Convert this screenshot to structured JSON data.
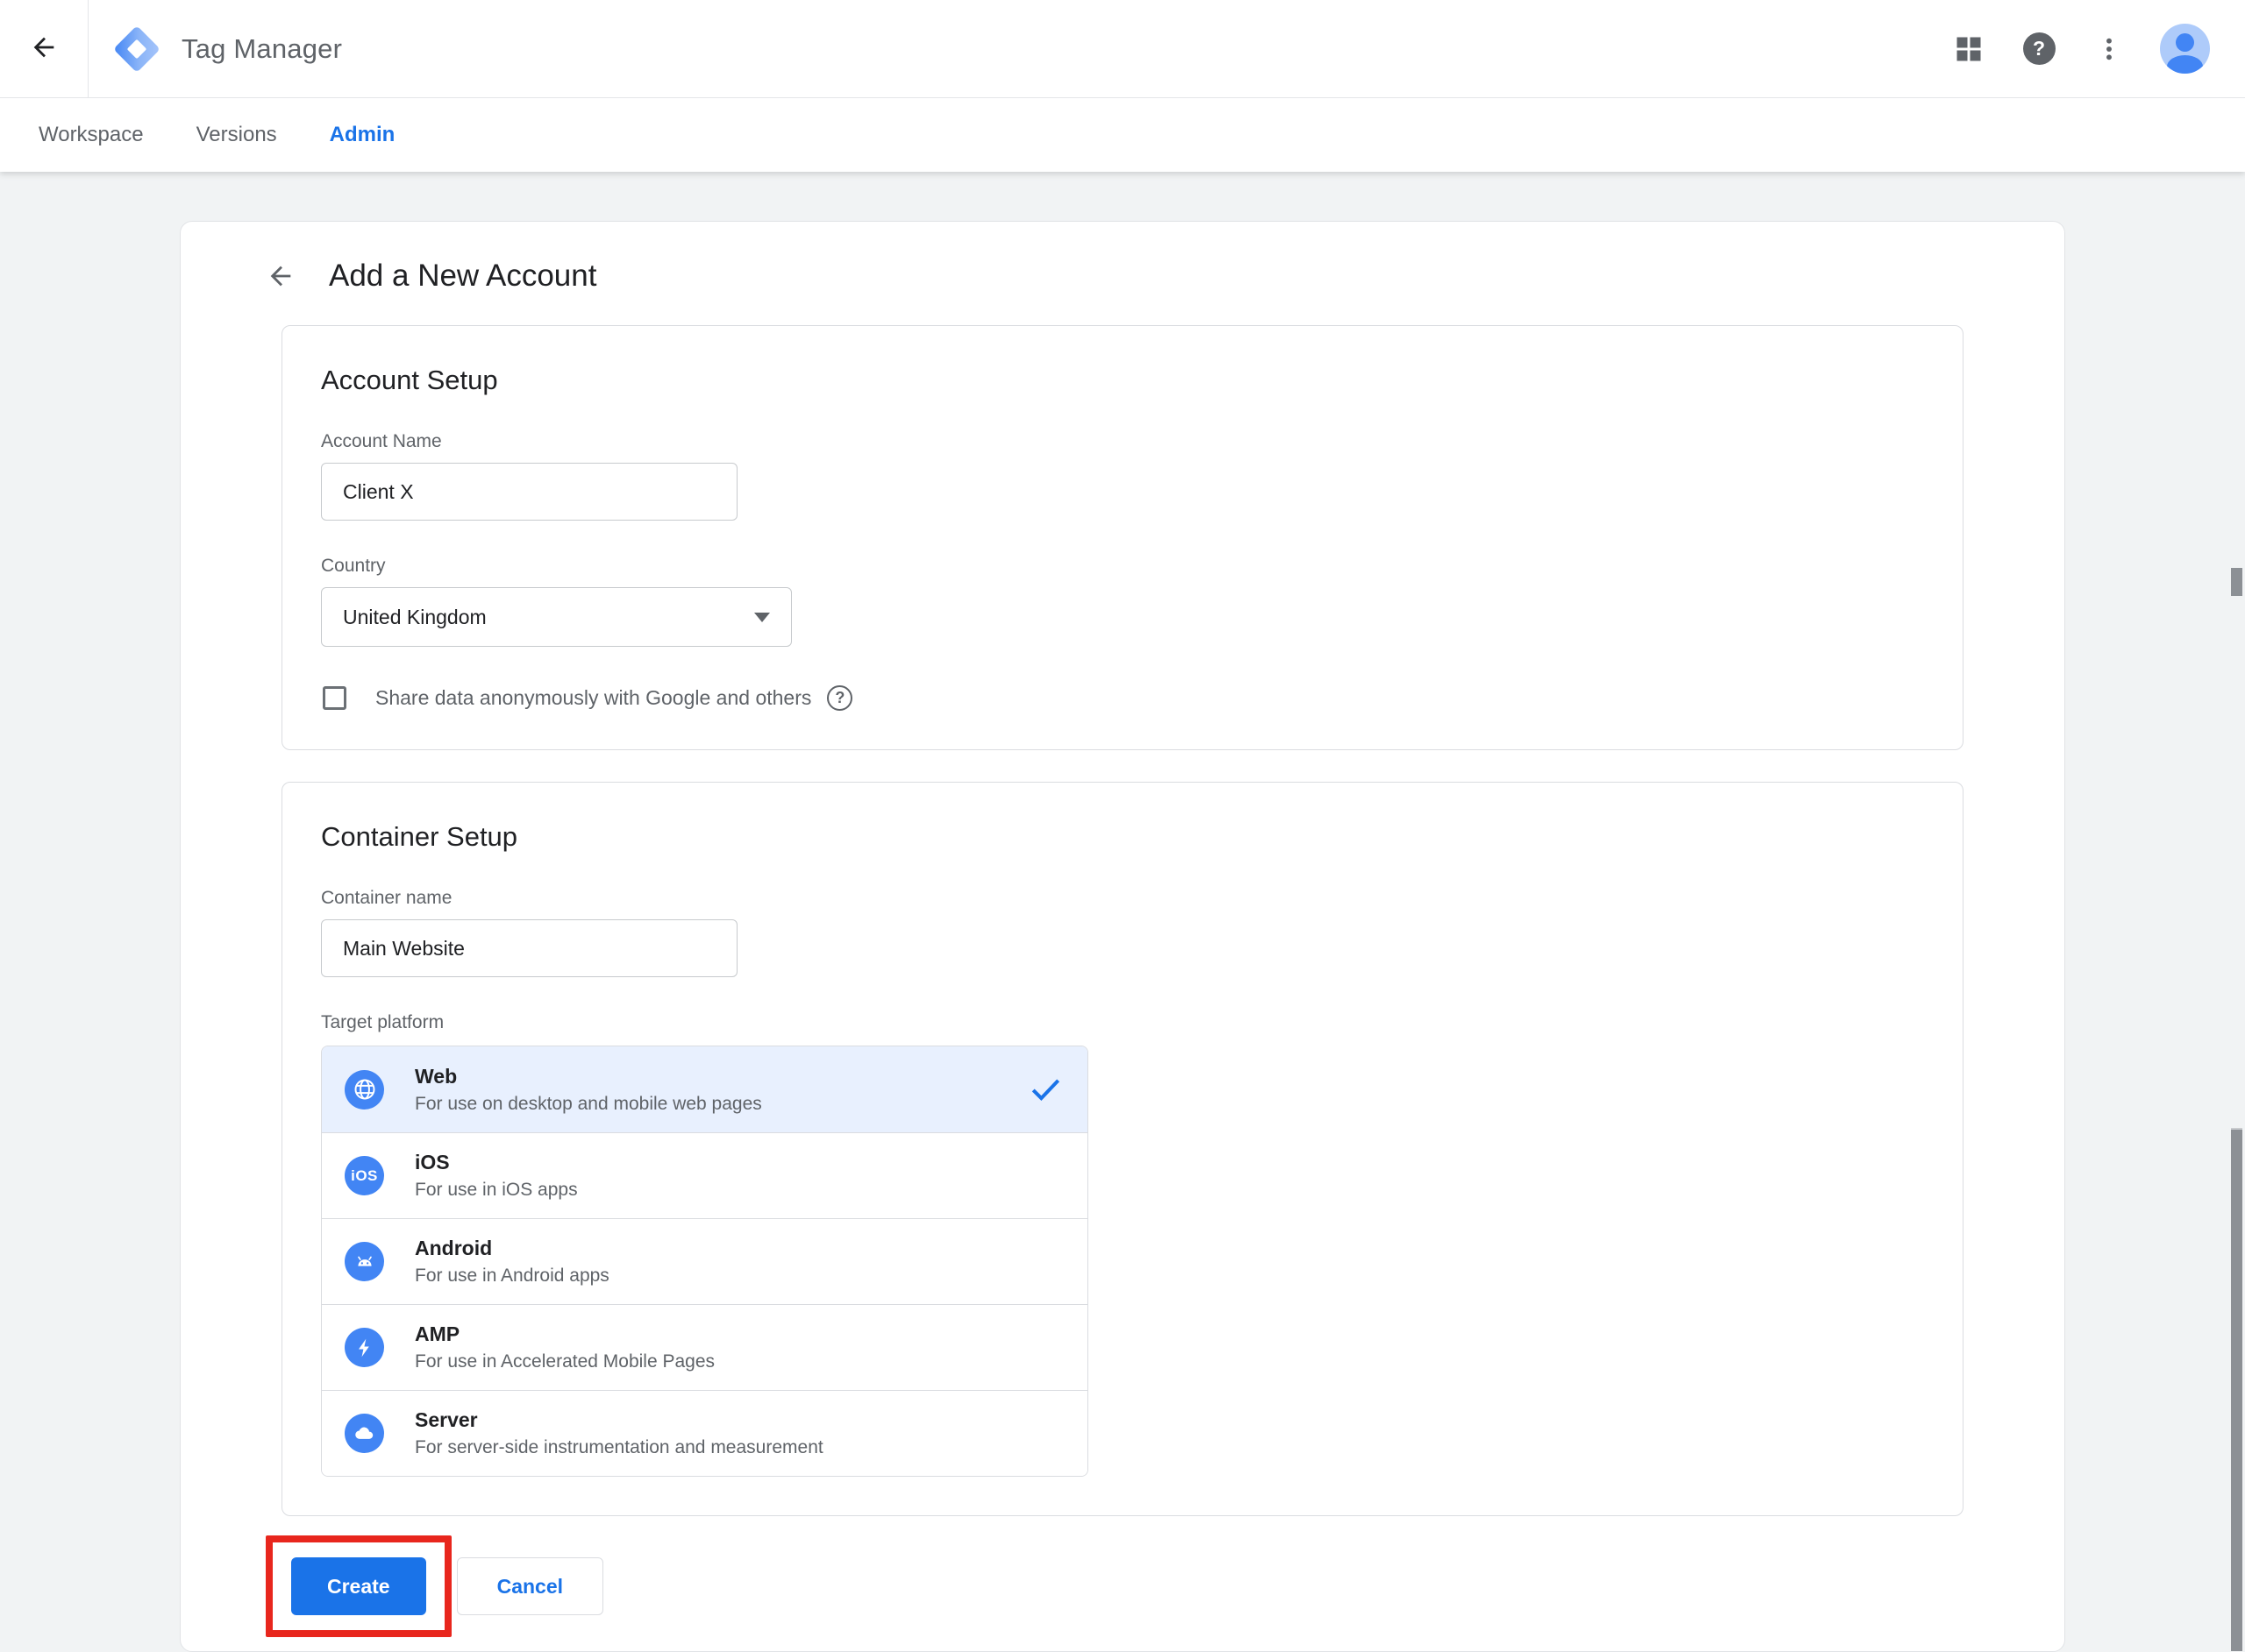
{
  "header": {
    "title": "Tag Manager",
    "icons": {
      "back": "arrow-left-icon",
      "apps": "apps-grid-icon",
      "help": "help-icon",
      "more": "kebab-menu-icon",
      "avatar": "user-avatar"
    },
    "glyphs": {
      "question_mark": "?"
    }
  },
  "nav_tabs": {
    "items": [
      {
        "label": "Workspace",
        "active": false
      },
      {
        "label": "Versions",
        "active": false
      },
      {
        "label": "Admin",
        "active": true
      }
    ]
  },
  "page": {
    "title": "Add a New Account"
  },
  "account_setup": {
    "title": "Account Setup",
    "account_name_label": "Account Name",
    "account_name_value": "Client X",
    "country_label": "Country",
    "country_value": "United Kingdom",
    "share_checkbox_label": "Share data anonymously with Google and others",
    "share_checkbox_checked": false,
    "help_glyph": "?"
  },
  "container_setup": {
    "title": "Container Setup",
    "container_name_label": "Container name",
    "container_name_value": "Main Website",
    "target_platform_label": "Target platform",
    "platforms": [
      {
        "name": "Web",
        "description": "For use on desktop and mobile web pages",
        "selected": true,
        "icon": "globe-icon"
      },
      {
        "name": "iOS",
        "description": "For use in iOS apps",
        "selected": false,
        "icon": "ios-icon",
        "icon_text": "iOS"
      },
      {
        "name": "Android",
        "description": "For use in Android apps",
        "selected": false,
        "icon": "android-icon"
      },
      {
        "name": "AMP",
        "description": "For use in Accelerated Mobile Pages",
        "selected": false,
        "icon": "amp-bolt-icon"
      },
      {
        "name": "Server",
        "description": "For server-side instrumentation and measurement",
        "selected": false,
        "icon": "cloud-icon"
      }
    ]
  },
  "actions": {
    "create": "Create",
    "cancel": "Cancel"
  },
  "annotation": {
    "type": "red-highlight-box",
    "target": "create-button",
    "color": "#e8261d"
  },
  "colors": {
    "accent_blue": "#1a73e8",
    "icon_blue": "#4285f4",
    "selected_row_bg": "#e8f0fe",
    "page_bg": "#f1f3f4",
    "border": "#dadce0",
    "text_primary": "#202124",
    "text_secondary": "#5f6368",
    "annotation_red": "#e8261d"
  }
}
